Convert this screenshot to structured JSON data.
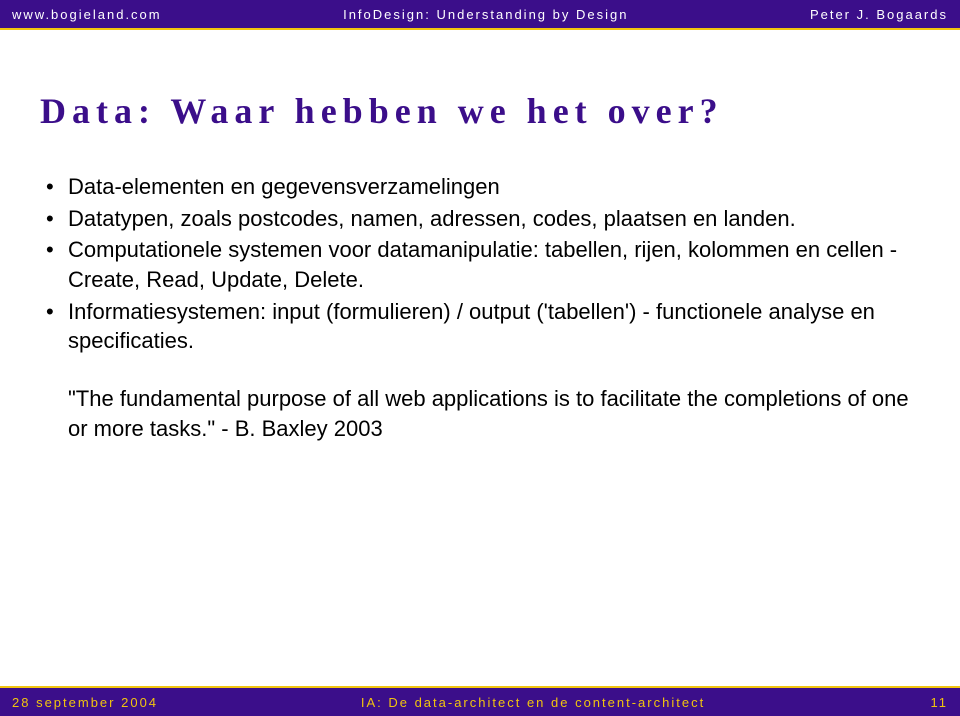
{
  "header": {
    "left": "www.bogieland.com",
    "center": "InfoDesign: Understanding by Design",
    "right": "Peter J. Bogaards"
  },
  "content": {
    "title": "Data: Waar hebben we het over?",
    "bullets": [
      "Data-elementen en gegevensverzamelingen",
      "Datatypen, zoals postcodes, namen, adressen, codes, plaatsen en landen.",
      "Computationele systemen voor datamanipulatie: tabellen, rijen, kolommen en cellen - Create, Read, Update, Delete.",
      "Informatiesystemen: input (formulieren) / output ('tabellen') - functionele analyse en specificaties."
    ],
    "quote": "\"The fundamental purpose of all web applications is to facilitate the completions of one or more tasks.\" - B. Baxley 2003"
  },
  "footer": {
    "left": "28 september 2004",
    "center": "IA: De data-architect en de content-architect",
    "right": "11"
  }
}
